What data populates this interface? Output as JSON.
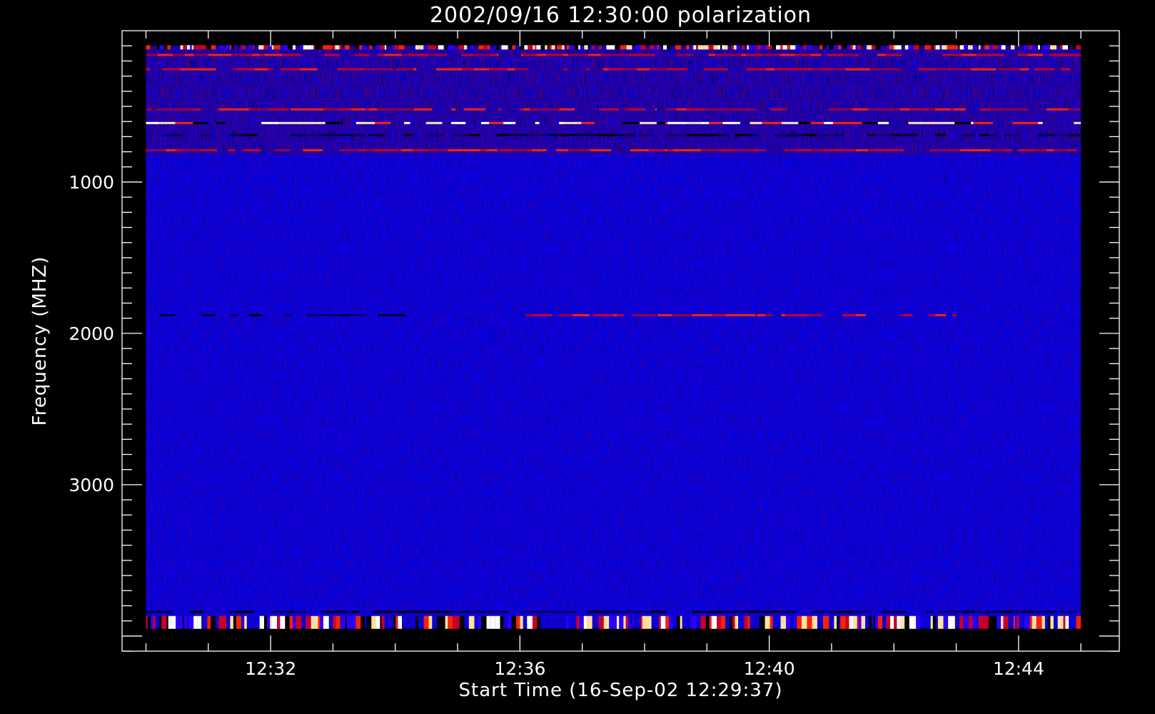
{
  "chart_data": {
    "type": "heatmap",
    "title": "2002/09/16 12:30:00 polarization",
    "xlabel": "Start Time (16-Sep-02 12:29:37)",
    "ylabel": "Frequency (MHZ)",
    "x_axis": {
      "unit": "time",
      "range": [
        "12:29:37",
        "12:45:37"
      ],
      "data_range": [
        "12:30:00",
        "12:45:00"
      ],
      "major_ticks": [
        "12:32",
        "12:36",
        "12:40",
        "12:44"
      ],
      "minor_tick_interval_minutes": 1
    },
    "y_axis": {
      "unit": "MHz",
      "inverted": true,
      "range": [
        0,
        4100
      ],
      "data_range": [
        100,
        3950
      ],
      "major_ticks": [
        1000,
        2000,
        3000
      ],
      "minor_tick_interval": 100
    },
    "colormap": {
      "background": "#0000ff",
      "levels": [
        "#000000",
        "#1a00d8",
        "#0000ff",
        "#c80028",
        "#ff2000",
        "#ffe0c0",
        "#ffffff"
      ]
    },
    "features": [
      {
        "kind": "band",
        "freq": 110,
        "intensity": "mixed",
        "start": "12:30:00",
        "end": "12:45:00"
      },
      {
        "kind": "band",
        "freq": 160,
        "intensity": "red",
        "start": "12:30:00",
        "end": "12:45:00"
      },
      {
        "kind": "band",
        "freq": 255,
        "intensity": "red",
        "start": "12:30:00",
        "end": "12:45:00"
      },
      {
        "kind": "band",
        "freq": 520,
        "intensity": "red",
        "start": "12:30:00",
        "end": "12:45:00"
      },
      {
        "kind": "band",
        "freq": 610,
        "intensity": "bright",
        "start": "12:30:00",
        "end": "12:45:00"
      },
      {
        "kind": "band",
        "freq": 690,
        "intensity": "dark",
        "start": "12:30:00",
        "end": "12:45:00"
      },
      {
        "kind": "band",
        "freq": 790,
        "intensity": "red",
        "start": "12:30:00",
        "end": "12:45:00"
      },
      {
        "kind": "band",
        "freq": 1880,
        "intensity": "dark",
        "start": "12:30:00",
        "end": "12:34:10"
      },
      {
        "kind": "band",
        "freq": 1880,
        "intensity": "red",
        "start": "12:36:00",
        "end": "12:43:00"
      },
      {
        "kind": "band",
        "freq": 3840,
        "intensity": "dark",
        "start": "12:30:00",
        "end": "12:45:00"
      },
      {
        "kind": "band",
        "freq": 3910,
        "intensity": "mixed",
        "start": "12:30:00",
        "end": "12:45:00"
      }
    ]
  }
}
